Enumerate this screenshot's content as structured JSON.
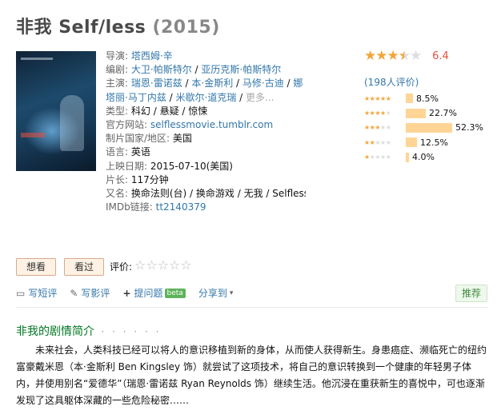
{
  "header": {
    "title_cn": "非我",
    "title_en": "Self/less",
    "year": "(2015)"
  },
  "info": {
    "director_label": "导演:",
    "director": "塔西姆·辛",
    "writers_label": "编剧:",
    "writers": [
      "大卫·帕斯特尔",
      "亚历克斯·帕斯特尔"
    ],
    "cast_label": "主演:",
    "cast": [
      "瑞恩·雷诺兹",
      "本·金斯利",
      "马修·古迪",
      "娜塔丽·马丁内兹",
      "米歇尔·道克瑞"
    ],
    "more": "更多...",
    "genre_label": "类型:",
    "genres": [
      "科幻",
      "悬疑",
      "惊悚"
    ],
    "website_label": "官方网站:",
    "website": "selflessmovie.tumblr.com",
    "country_label": "制片国家/地区:",
    "country": "美国",
    "language_label": "语言:",
    "language": "英语",
    "release_label": "上映日期:",
    "release": "2015-07-10(美国)",
    "runtime_label": "片长:",
    "runtime": "117分钟",
    "aka_label": "又名:",
    "aka": "换命法则(台) / 换命游戏 / 无我 / Selfless",
    "imdb_label": "IMDb链接:",
    "imdb": "tt2140379"
  },
  "rating": {
    "score": "6.4",
    "stars": 3.5,
    "votes": "(198人评价)",
    "distribution": [
      {
        "stars": 5,
        "percent": "8.5%",
        "value": 8.5
      },
      {
        "stars": 4,
        "percent": "22.7%",
        "value": 22.7
      },
      {
        "stars": 3,
        "percent": "52.3%",
        "value": 52.3
      },
      {
        "stars": 2,
        "percent": "12.5%",
        "value": 12.5
      },
      {
        "stars": 1,
        "percent": "4.0%",
        "value": 4.0
      }
    ],
    "color_star": "#f3a53a",
    "color_bar": "#ffd596"
  },
  "interest": {
    "want_label": "想看",
    "seen_label": "看过",
    "rate_label": "评价:"
  },
  "actions": {
    "short_review": "写短评",
    "review": "写影评",
    "question": "提问题",
    "beta": "beta",
    "share": "分享到",
    "recommend": "推荐"
  },
  "synopsis": {
    "title": "非我的剧情简介",
    "dots": "· · · · · ·",
    "text": "未来社会，人类科技已经可以将人的意识移植到新的身体，从而使人获得新生。身患癌症、濒临死亡的纽约富豪戴米恩（本·金斯利 Ben Kingsley 饰）就尝试了这项技术，将自己的意识转换到一个健康的年轻男子体内，并使用别名“爱德华”（瑞恩·雷诺兹 Ryan Reynolds 饰）继续生活。他沉浸在重获新生的喜悦中，可也逐渐发现了这具躯体深藏的一些危险秘密……"
  }
}
